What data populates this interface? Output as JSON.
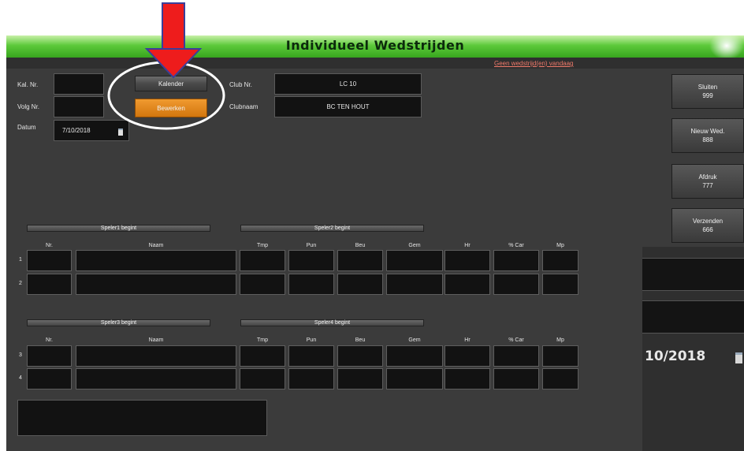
{
  "window": {
    "title": "Individueel Wedstrijden"
  },
  "notice": {
    "link": "Geen wedstrijd(en) vandaag"
  },
  "form": {
    "kal_nr_label": "Kal. Nr.",
    "volg_nr_label": "Volg Nr.",
    "datum_label": "Datum",
    "datum_value": "7/10/2018",
    "club_nr_label": "Club Nr.",
    "club_nr_value": "LC 10",
    "clubnaam_label": "Clubnaam",
    "clubnaam_value": "BC TEN HOUT",
    "kalender_button": "Kalender",
    "bewerken_button": "Bewerken"
  },
  "side_buttons": [
    {
      "label": "Sluiten",
      "code": "999"
    },
    {
      "label": "Nieuw Wed.",
      "code": "888"
    },
    {
      "label": "Afdruk",
      "code": "777"
    },
    {
      "label": "Verzenden",
      "code": "666"
    }
  ],
  "match1": {
    "speler1": "Speler1 begint",
    "speler2": "Speler2 begint",
    "rows": [
      "1",
      "2"
    ]
  },
  "match2": {
    "speler1": "Speler3 begint",
    "speler2": "Speler4 begint",
    "rows": [
      "3",
      "4"
    ]
  },
  "columns": [
    "Nr.",
    "Naam",
    "Tmp",
    "Pun",
    "Beu",
    "Gem",
    "Hr",
    "% Car",
    "Mp"
  ],
  "zoom_date": "10/2018",
  "colors": {
    "accent_green": "#37a51e",
    "orange": "#e0861a",
    "annotation_red": "#ee1c1c"
  }
}
